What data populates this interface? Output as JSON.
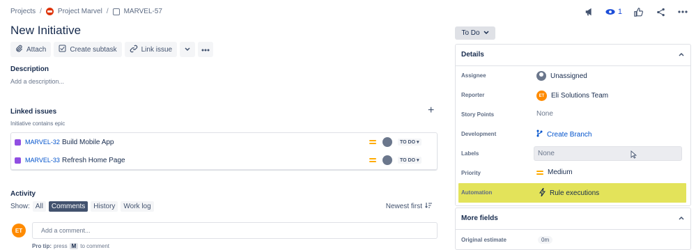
{
  "breadcrumbs": {
    "projects": "Projects",
    "project": "Project Marvel",
    "issue_key": "MARVEL-57"
  },
  "header": {
    "watch_count": "1",
    "icons": [
      "feedback-megaphone-icon",
      "eye-icon",
      "thumbs-up-icon",
      "share-icon",
      "more-icon"
    ]
  },
  "title": "New Initiative",
  "toolbar": {
    "attach": "Attach",
    "create_subtask": "Create subtask",
    "link_issue": "Link issue"
  },
  "description": {
    "heading": "Description",
    "placeholder": "Add a description..."
  },
  "linked": {
    "heading": "Linked issues",
    "relation": "Initiative contains epic",
    "items": [
      {
        "key": "MARVEL-32",
        "summary": "Build Mobile App",
        "status": "TO DO"
      },
      {
        "key": "MARVEL-33",
        "summary": "Refresh Home Page",
        "status": "TO DO"
      }
    ]
  },
  "activity": {
    "heading": "Activity",
    "show_label": "Show:",
    "tabs": [
      "All",
      "Comments",
      "History",
      "Work log"
    ],
    "active_tab": "Comments",
    "sort": "Newest first",
    "user_initials": "ET",
    "comment_placeholder": "Add a comment...",
    "protip_prefix": "Pro tip:",
    "protip_press": "press",
    "protip_key": "M",
    "protip_suffix": "to comment"
  },
  "status_button": "To Do",
  "details": {
    "heading": "Details",
    "assignee_label": "Assignee",
    "assignee": "Unassigned",
    "reporter_label": "Reporter",
    "reporter": "Eli Solutions Team",
    "reporter_initials": "ET",
    "story_points_label": "Story Points",
    "story_points": "None",
    "development_label": "Development",
    "development": "Create Branch",
    "labels_label": "Labels",
    "labels": "None",
    "priority_label": "Priority",
    "priority": "Medium",
    "automation_label": "Automation",
    "automation": "Rule executions"
  },
  "more_fields": {
    "heading": "More fields",
    "original_estimate_label": "Original estimate",
    "original_estimate": "0m"
  },
  "colors": {
    "accent": "#0052cc",
    "priority_medium": "#ffab00",
    "epic": "#904ee2",
    "automation_highlight": "#e3e35a"
  }
}
